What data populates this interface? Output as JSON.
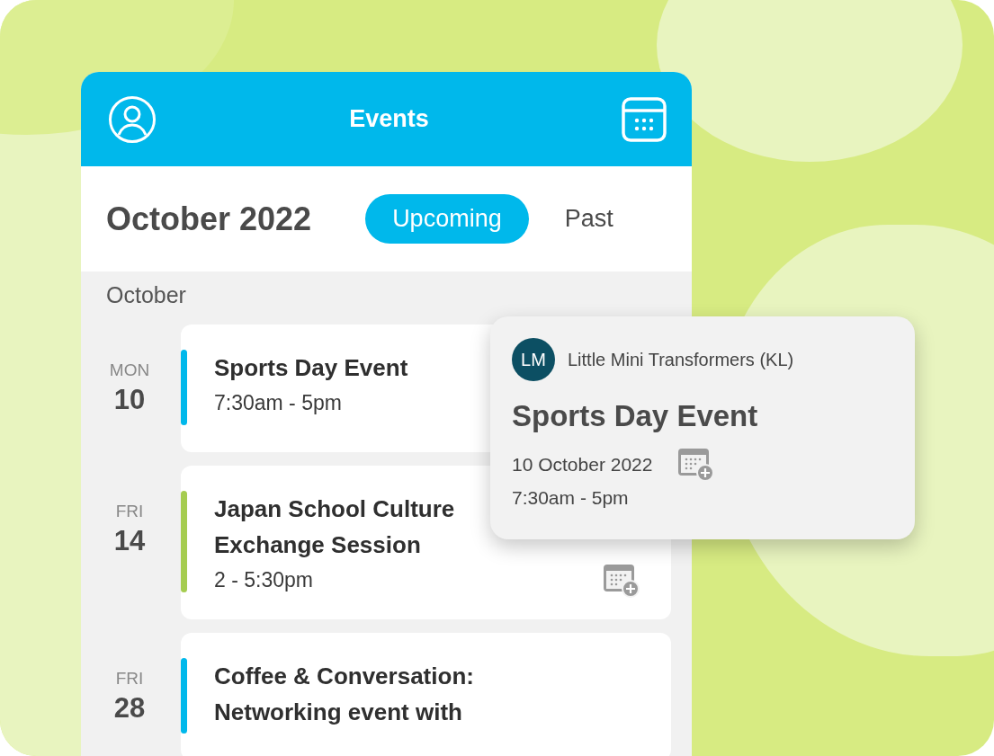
{
  "header": {
    "title": "Events"
  },
  "month_title": "October 2022",
  "tabs": [
    {
      "label": "Upcoming",
      "selected": true
    },
    {
      "label": "Past",
      "selected": false
    }
  ],
  "section_label": "October",
  "events": [
    {
      "weekday": "MON",
      "day": "10",
      "title": "Sports Day Event",
      "time": "7:30am - 5pm",
      "color": "#00b8eb",
      "add_icon": false
    },
    {
      "weekday": "FRI",
      "day": "14",
      "title": "Japan School Culture Exchange Session",
      "time": "2 - 5:30pm",
      "color": "#a5cc50",
      "add_icon": true
    },
    {
      "weekday": "FRI",
      "day": "28",
      "title": "Coffee & Conversation: Networking event with",
      "color": "#00b8eb",
      "add_icon": false
    }
  ],
  "popup": {
    "initials": "LM",
    "organizer": "Little Mini Transformers (KL)",
    "title": "Sports Day Event",
    "date": "10 October 2022",
    "time": "7:30am - 5pm"
  }
}
